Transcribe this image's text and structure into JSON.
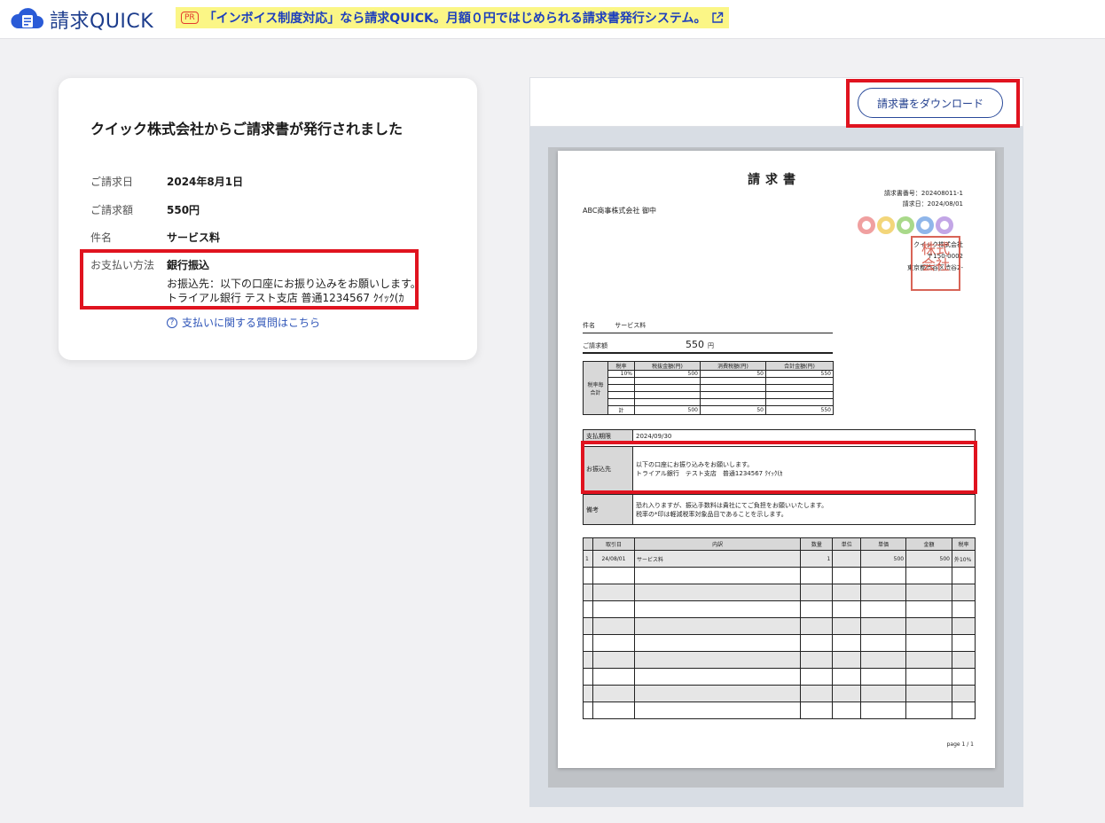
{
  "header": {
    "logo_text": "請求QUICK",
    "promo_badge": "PR",
    "promo_text": "「インボイス制度対応」なら請求QUICK。月額０円ではじめられる請求書発行システム。"
  },
  "summary": {
    "title": "クイック株式会社からご請求書が発行されました",
    "issue_date_label": "ご請求日",
    "issue_date": "2024年8月1日",
    "amount_label": "ご請求額",
    "amount": "550円",
    "subject_label": "件名",
    "subject": "サービス料",
    "payment_method_label": "お支払い方法",
    "payment_method": "銀行振込",
    "payment_detail_1": "お振込先：以下の口座にお振り込みをお願いします。",
    "payment_detail_2": "トライアル銀行 テスト支店 普通1234567 ｸｲｯｸ(ｶ",
    "help_link": "支払いに関する質問はこちら"
  },
  "preview": {
    "download_label": "請求書をダウンロード"
  },
  "invoice": {
    "title": "請求書",
    "number": "請求書番号：202408011-1",
    "date": "請求日：2024/08/01",
    "recipient": "ABC商事株式会社 御中",
    "company": "クイック株式会社",
    "postal": "〒150-0002",
    "address": "東京都渋谷区渋谷2-",
    "stamp": "株式会社",
    "subject_label": "件名",
    "subject": "サービス料",
    "amount_label": "ご請求額",
    "amount": "550",
    "yen": "円",
    "tax_side_label": "税率毎合計",
    "tax_headers": [
      "税率",
      "税抜金額(円)",
      "消費税額(円)",
      "合計金額(円)"
    ],
    "tax_row": [
      "10%",
      "500",
      "50",
      "550"
    ],
    "tax_total": [
      "計",
      "500",
      "50",
      "550"
    ],
    "due_label": "支払期限",
    "due": "2024/09/30",
    "bank_label": "お振込先",
    "bank_1": "以下の口座にお振り込みをお願いします。",
    "bank_2": "トライアル銀行　テスト支店　普通1234567 ｸｲｯｸ(ｶ",
    "note_label": "備考",
    "note_1": "恐れ入りますが、振込手数料は貴社にてご負担をお願いいたします。",
    "note_2": "税率の*印は軽減税率対象品目であることを示します。",
    "item_headers": [
      "",
      "取引日",
      "内訳",
      "数量",
      "単位",
      "単価",
      "金額",
      "税率"
    ],
    "item_row": [
      "1",
      "24/08/01",
      "サービス料",
      "1",
      "",
      "500",
      "500",
      "外10%"
    ],
    "page": "page 1 / 1",
    "circle_colors": [
      "#f0a0a0",
      "#f3d67a",
      "#a9d98a",
      "#8fb6ea",
      "#c3a6e6"
    ]
  }
}
